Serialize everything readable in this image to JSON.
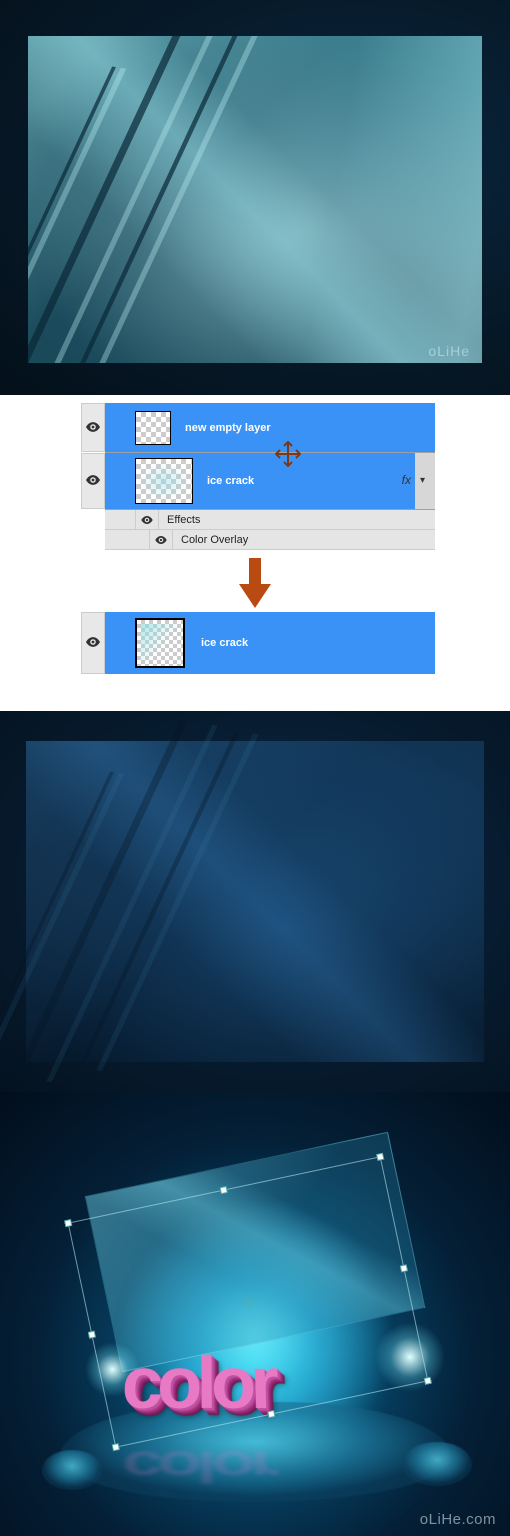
{
  "panel1": {
    "watermark": "oLiHe"
  },
  "layers_panel": {
    "top": [
      {
        "name": "new empty layer",
        "fx": false
      },
      {
        "name": "ice crack",
        "fx": true
      }
    ],
    "fx_label": "fx",
    "effects_label": "Effects",
    "color_overlay_label": "Color Overlay",
    "merged": {
      "name": "ice crack"
    }
  },
  "panel4": {
    "text": "color",
    "watermark": "oLiHe.com"
  }
}
